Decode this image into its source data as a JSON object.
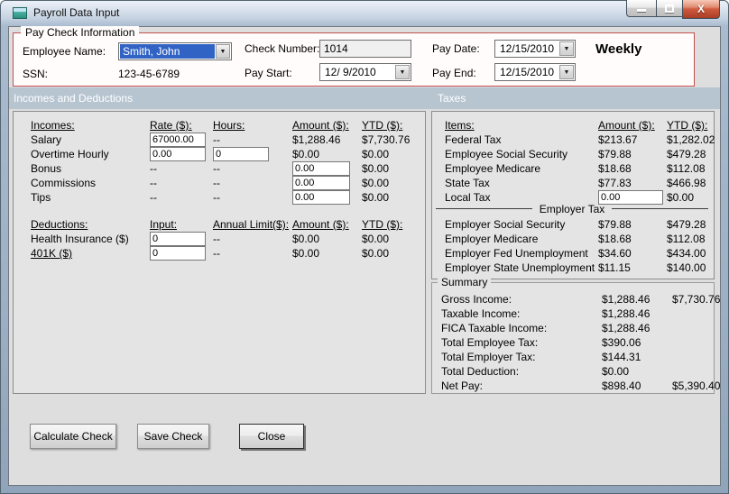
{
  "window": {
    "title": "Payroll Data Input",
    "close_glyph": "X"
  },
  "paycheck": {
    "legend": "Pay Check Information",
    "employee_name_label": "Employee Name:",
    "employee_name_value": "Smith, John",
    "ssn_label": "SSN:",
    "ssn_value": "123-45-6789",
    "check_number_label": "Check Number:",
    "check_number_value": "1014",
    "pay_start_label": "Pay Start:",
    "pay_start_value": "12/ 9/2010",
    "pay_date_label": "Pay Date:",
    "pay_date_value": "12/15/2010",
    "pay_end_label": "Pay End:",
    "pay_end_value": "12/15/2010",
    "frequency": "Weekly"
  },
  "bands": {
    "left": "Incomes and Deductions",
    "right": "Taxes"
  },
  "incomes": {
    "headers": {
      "name": "Incomes:",
      "rate": "Rate ($):",
      "hours": "Hours:",
      "amount": "Amount ($):",
      "ytd": "YTD ($):"
    },
    "rows": [
      {
        "name": "Salary",
        "rate": "67000.00",
        "hours": "--",
        "amount": "$1,288.46",
        "ytd": "$7,730.76"
      },
      {
        "name": "Overtime Hourly",
        "rate": "0.00",
        "hours": "0",
        "amount": "$0.00",
        "ytd": "$0.00"
      },
      {
        "name": "Bonus",
        "rate": "--",
        "hours": "--",
        "amount": "0.00",
        "ytd": "$0.00"
      },
      {
        "name": "Commissions",
        "rate": "--",
        "hours": "--",
        "amount": "0.00",
        "ytd": "$0.00"
      },
      {
        "name": "Tips",
        "rate": "--",
        "hours": "--",
        "amount": "0.00",
        "ytd": "$0.00"
      }
    ]
  },
  "deductions": {
    "headers": {
      "name": "Deductions:",
      "input": "Input:",
      "limit": "Annual Limit($):",
      "amount": "Amount ($):",
      "ytd": "YTD ($):"
    },
    "rows": [
      {
        "name": "Health Insurance ($)",
        "input": "0",
        "limit": "--",
        "amount": "$0.00",
        "ytd": "$0.00"
      },
      {
        "name": "401K ($)",
        "input": "0",
        "limit": "--",
        "amount": "$0.00",
        "ytd": "$0.00"
      }
    ]
  },
  "taxes": {
    "headers": {
      "name": "Items:",
      "amount": "Amount ($):",
      "ytd": "YTD ($):"
    },
    "rows": [
      {
        "name": "Federal Tax",
        "amount": "$213.67",
        "ytd": "$1,282.02"
      },
      {
        "name": "Employee Social Security",
        "amount": "$79.88",
        "ytd": "$479.28"
      },
      {
        "name": "Employee Medicare",
        "amount": "$18.68",
        "ytd": "$112.08"
      },
      {
        "name": "State Tax",
        "amount": "$77.83",
        "ytd": "$466.98"
      },
      {
        "name": "Local Tax",
        "amount": "0.00",
        "ytd": "$0.00"
      }
    ],
    "employer_label": "Employer Tax",
    "employer_rows": [
      {
        "name": "Employer Social Security",
        "amount": "$79.88",
        "ytd": "$479.28"
      },
      {
        "name": "Employer Medicare",
        "amount": "$18.68",
        "ytd": "$112.08"
      },
      {
        "name": "Employer Fed Unemployment",
        "amount": "$34.60",
        "ytd": "$434.00"
      },
      {
        "name": "Employer State Unemployment",
        "amount": "$11.15",
        "ytd": "$140.00"
      }
    ]
  },
  "summary": {
    "legend": "Summary",
    "rows": [
      {
        "name": "Gross Income:",
        "amount": "$1,288.46",
        "ytd": "$7,730.76"
      },
      {
        "name": "Taxable Income:",
        "amount": "$1,288.46",
        "ytd": ""
      },
      {
        "name": "FICA Taxable Income:",
        "amount": "$1,288.46",
        "ytd": ""
      },
      {
        "name": "Total Employee Tax:",
        "amount": "$390.06",
        "ytd": ""
      },
      {
        "name": "Total Employer Tax:",
        "amount": "$144.31",
        "ytd": ""
      },
      {
        "name": "Total Deduction:",
        "amount": "$0.00",
        "ytd": ""
      },
      {
        "name": "Net Pay:",
        "amount": "$898.40",
        "ytd": "$5,390.40"
      }
    ]
  },
  "buttons": {
    "calculate": "Calculate Check",
    "save": "Save Check",
    "close": "Close"
  },
  "colors": {
    "accent_red": "#c0504d",
    "band_blue": "#b7c5d1",
    "selection_blue": "#3163c5"
  }
}
